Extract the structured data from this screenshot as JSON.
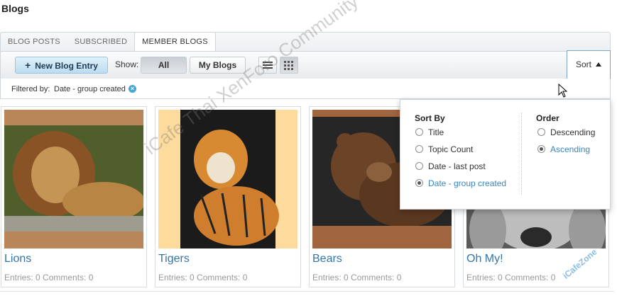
{
  "page": {
    "title": "Blogs"
  },
  "tabs": [
    {
      "label": "BLOG POSTS",
      "active": false
    },
    {
      "label": "SUBSCRIBED",
      "active": false
    },
    {
      "label": "MEMBER BLOGS",
      "active": true
    }
  ],
  "toolbar": {
    "new_entry_label": "New Blog Entry",
    "show_label": "Show:",
    "all_label": "All",
    "my_blogs_label": "My Blogs",
    "sort_label": "Sort"
  },
  "filter": {
    "label": "Filtered by:",
    "value": "Date - group created"
  },
  "blogs": [
    {
      "title": "Lions",
      "meta": "Entries: 0 Comments: 0"
    },
    {
      "title": "Tigers",
      "meta": "Entries: 0 Comments: 0"
    },
    {
      "title": "Bears",
      "meta": "Entries: 0 Comments: 0"
    },
    {
      "title": "Oh My!",
      "meta": "Entries: 0 Comments: 0"
    }
  ],
  "sort_menu": {
    "sort_by_heading": "Sort By",
    "sort_by_options": [
      {
        "label": "Title",
        "selected": false
      },
      {
        "label": "Topic Count",
        "selected": false
      },
      {
        "label": "Date - last post",
        "selected": false
      },
      {
        "label": "Date - group created",
        "selected": true
      }
    ],
    "order_heading": "Order",
    "order_options": [
      {
        "label": "Descending",
        "selected": false
      },
      {
        "label": "Ascending",
        "selected": true
      }
    ]
  },
  "watermark": {
    "text": "iCafe Thai XenForo Community",
    "corner_text": "iCafeZone"
  },
  "colors": {
    "link": "#3575a8",
    "accent": "#4aa4d6",
    "selected_option": "#3a86bd"
  }
}
